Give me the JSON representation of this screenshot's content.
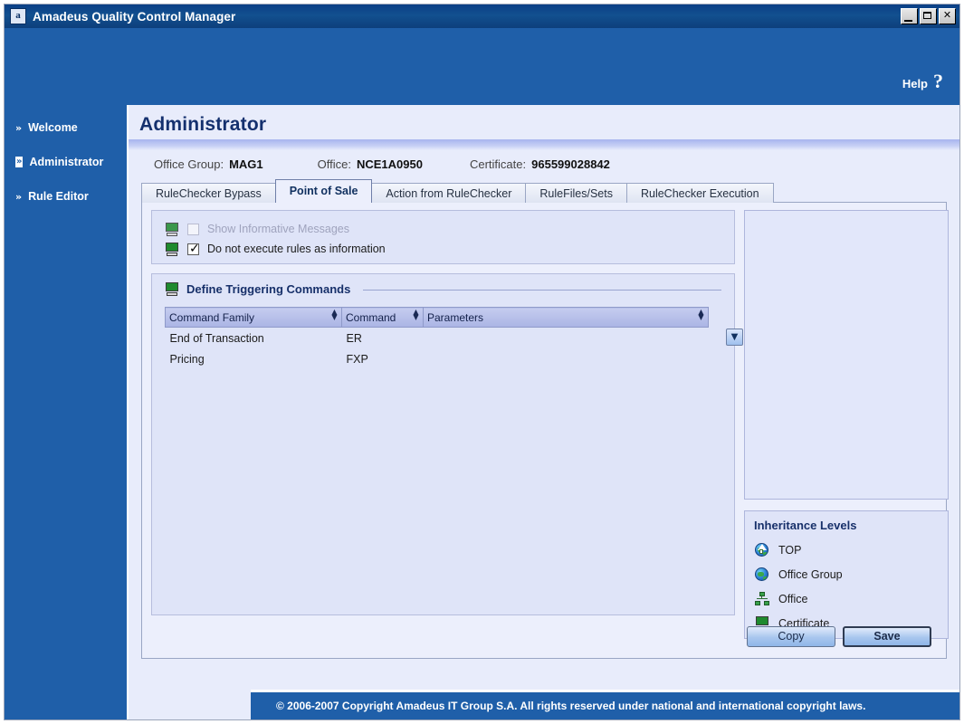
{
  "window": {
    "title": "Amadeus Quality Control Manager",
    "app_icon": "a",
    "buttons": {
      "minimize": "minimize-icon",
      "maximize": "maximize-icon",
      "close": "✕"
    }
  },
  "banner": {
    "help_label": "Help",
    "help_glyph": "?"
  },
  "sidebar": {
    "items": [
      {
        "label": "Welcome",
        "chevron": "»",
        "selected": false
      },
      {
        "label": "Administrator",
        "chevron": "»",
        "selected": true
      },
      {
        "label": "Rule Editor",
        "chevron": "»",
        "selected": false
      }
    ]
  },
  "page": {
    "title": "Administrator",
    "meta": [
      {
        "label": "Office Group:",
        "value": "MAG1"
      },
      {
        "label": "Office:",
        "value": "NCE1A0950"
      },
      {
        "label": "Certificate:",
        "value": "965599028842"
      }
    ]
  },
  "tabs": [
    {
      "label": "RuleChecker Bypass",
      "active": false
    },
    {
      "label": "Point of Sale",
      "active": true
    },
    {
      "label": "Action from RuleChecker",
      "active": false
    },
    {
      "label": "RuleFiles/Sets",
      "active": false
    },
    {
      "label": "RuleChecker Execution",
      "active": false
    }
  ],
  "options": [
    {
      "label": "Show Informative Messages",
      "checked": false,
      "enabled": false,
      "icon": "certificate-monitor-icon"
    },
    {
      "label": "Do not execute rules as information",
      "checked": true,
      "enabled": true,
      "icon": "certificate-monitor-icon"
    }
  ],
  "commands_section": {
    "title": "Define Triggering Commands",
    "icon": "certificate-monitor-icon",
    "columns": [
      "Command Family",
      "Command",
      "Parameters"
    ],
    "rows": [
      {
        "family": "End of Transaction",
        "command": "ER",
        "parameters": ""
      },
      {
        "family": "Pricing",
        "command": "FXP",
        "parameters": ""
      }
    ],
    "row_dropdown_icon": "chevron-down-icon"
  },
  "inheritance": {
    "title": "Inheritance Levels",
    "levels": [
      {
        "label": "TOP",
        "icon": "globe-up-arrow-icon"
      },
      {
        "label": "Office Group",
        "icon": "globe-icon"
      },
      {
        "label": "Office",
        "icon": "network-nodes-icon"
      },
      {
        "label": "Certificate",
        "icon": "certificate-monitor-icon"
      }
    ]
  },
  "actions": {
    "copy_label": "Copy",
    "save_label": "Save"
  },
  "footer": {
    "copyright": "© 2006-2007 Copyright Amadeus IT Group S.A. All rights reserved under national and international copyright laws."
  },
  "colors": {
    "brand_blue": "#1f5fa9",
    "title_bar": "#0d3f7c",
    "content_bg": "#e8ecfb",
    "panel_bg": "#dfe4f8",
    "grid_header": "#aab4e4",
    "cell_highlight": "#fcfcc0",
    "heading_text": "#14306e"
  }
}
